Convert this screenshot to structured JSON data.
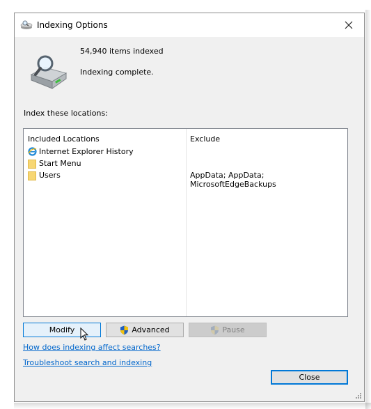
{
  "window": {
    "title": "Indexing Options",
    "title_icon": "indexing-options-icon",
    "close_icon": "close-icon"
  },
  "status": {
    "items_indexed": "54,940 items indexed",
    "state": "Indexing complete.",
    "icon": "search-drive-icon"
  },
  "locations": {
    "label": "Index these locations:",
    "headers": {
      "included": "Included Locations",
      "exclude": "Exclude"
    },
    "rows": [
      {
        "name": "Internet Explorer History",
        "icon": "internet-explorer-icon",
        "exclude": ""
      },
      {
        "name": "Start Menu",
        "icon": "folder-icon",
        "exclude": ""
      },
      {
        "name": "Users",
        "icon": "folder-icon",
        "exclude": "AppData; AppData; MicrosoftEdgeBackups"
      }
    ]
  },
  "buttons": {
    "modify": "Modify",
    "advanced": "Advanced",
    "pause": "Pause",
    "close": "Close"
  },
  "links": {
    "how_indexing": "How does indexing affect searches?",
    "troubleshoot": "Troubleshoot search and indexing"
  },
  "colors": {
    "link": "#0066cc",
    "focus_border": "#0078d7",
    "dialog_bg": "#f0f0f0"
  }
}
